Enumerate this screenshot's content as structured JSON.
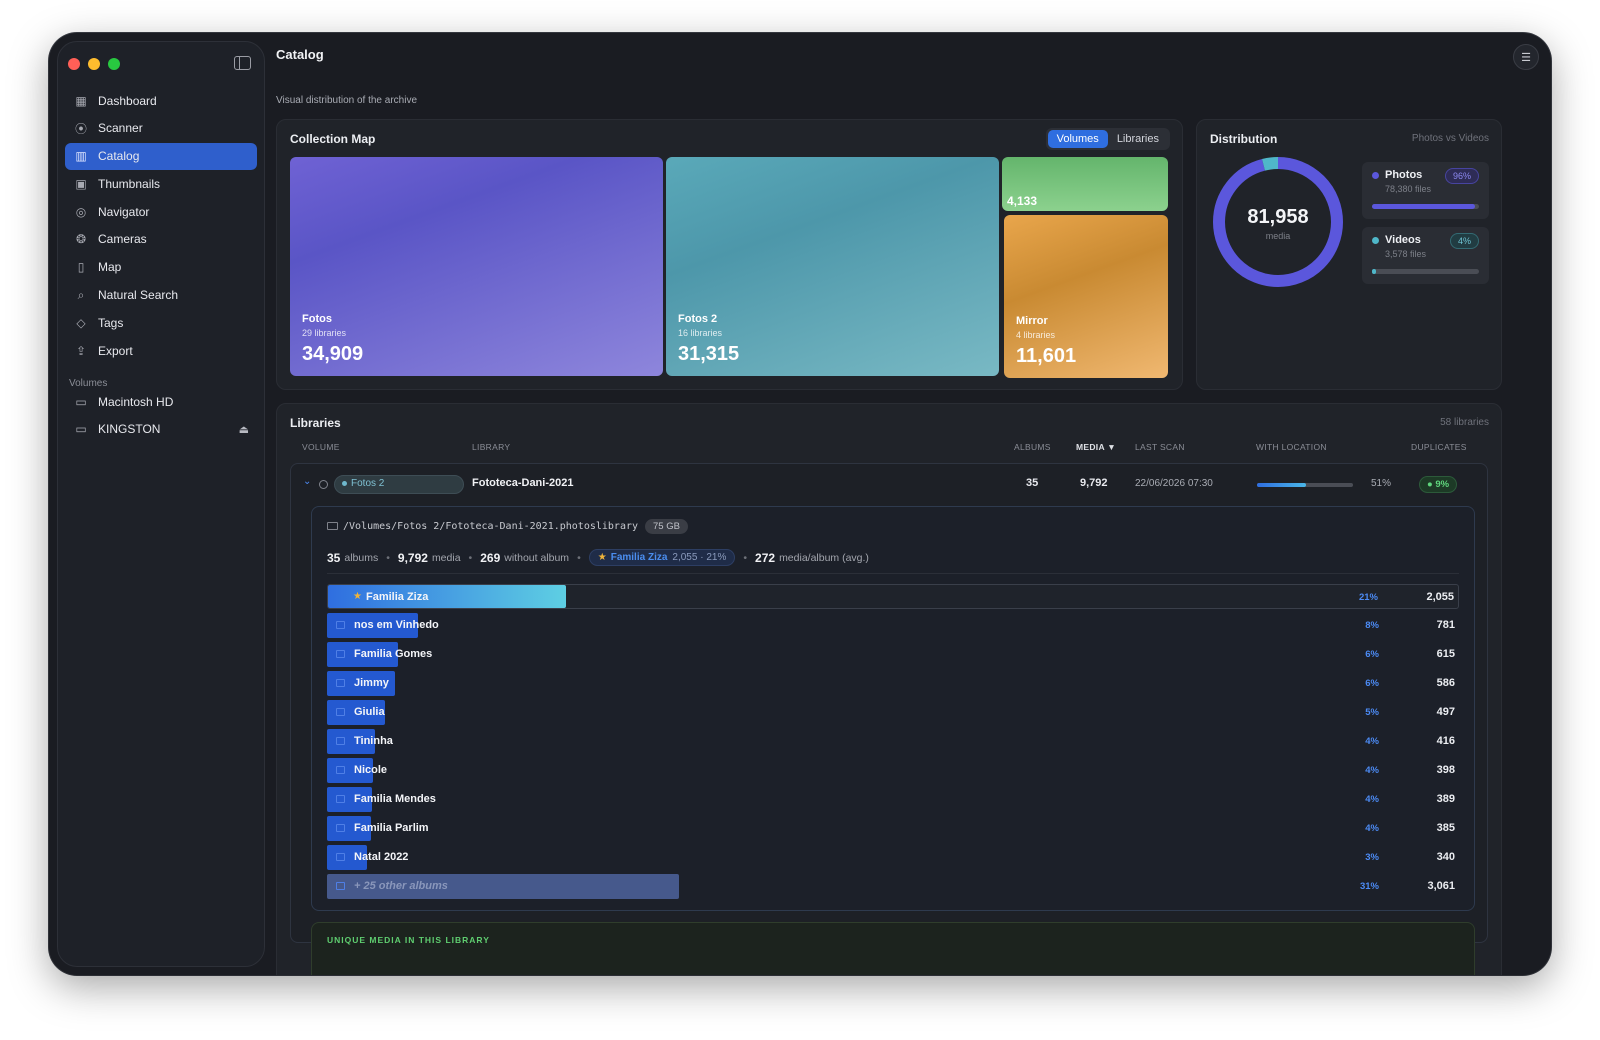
{
  "app": {
    "title": "Catalog",
    "subtitle": "Visual distribution of the archive"
  },
  "sidebar": {
    "items": [
      {
        "label": "Dashboard",
        "icon": "grid-icon",
        "glyph": "▦"
      },
      {
        "label": "Scanner",
        "icon": "broadcast-icon",
        "glyph": "⦿"
      },
      {
        "label": "Catalog",
        "icon": "catalog-icon",
        "glyph": "▥",
        "active": true
      },
      {
        "label": "Thumbnails",
        "icon": "photos-icon",
        "glyph": "▣"
      },
      {
        "label": "Navigator",
        "icon": "compass-icon",
        "glyph": "◎"
      },
      {
        "label": "Cameras",
        "icon": "aperture-icon",
        "glyph": "❂"
      },
      {
        "label": "Map",
        "icon": "map-icon",
        "glyph": "▯"
      },
      {
        "label": "Natural Search",
        "icon": "search-icon",
        "glyph": "⌕"
      },
      {
        "label": "Tags",
        "icon": "tag-icon",
        "glyph": "◇"
      },
      {
        "label": "Export",
        "icon": "share-icon",
        "glyph": "⇪"
      }
    ],
    "volumes_label": "Volumes",
    "volumes": [
      {
        "label": "Macintosh HD",
        "icon": "drive-icon"
      },
      {
        "label": "KINGSTON",
        "icon": "drive-icon",
        "eject": true
      }
    ]
  },
  "collection_map": {
    "title": "Collection Map",
    "toggle": [
      "Volumes",
      "Libraries"
    ],
    "toggle_selected": "Volumes",
    "tiles": [
      {
        "name": "Fotos",
        "sub": "29 libraries",
        "value": "34,909"
      },
      {
        "name": "Fotos 2",
        "sub": "16 libraries",
        "value": "31,315"
      },
      {
        "name": "",
        "sub": "",
        "value": "4,133"
      },
      {
        "name": "Mirror",
        "sub": "4 libraries",
        "value": "11,601"
      }
    ]
  },
  "distribution": {
    "title": "Distribution",
    "subtitle": "Photos vs Videos",
    "total": "81,958",
    "total_label": "media",
    "photos": {
      "name": "Photos",
      "files": "78,380 files",
      "pct": "96%",
      "fraction": 0.96,
      "color": "#5b57dc"
    },
    "videos": {
      "name": "Videos",
      "files": "3,578 files",
      "pct": "4%",
      "fraction": 0.04,
      "color": "#4fb7c9"
    }
  },
  "libraries": {
    "title": "Libraries",
    "count": "58 libraries",
    "headers": {
      "volume": "VOLUME",
      "library": "LIBRARY",
      "albums": "ALBUMS",
      "media": "MEDIA ▼",
      "last_scan": "LAST SCAN",
      "with_location": "WITH LOCATION",
      "duplicates": "DUPLICATES"
    },
    "row": {
      "volume": "Fotos 2",
      "library": "Fototeca-Dani-2021",
      "albums": "35",
      "media": "9,792",
      "last_scan": "22/06/2026 07:30",
      "location_pct": "51%",
      "location_fraction": 0.51,
      "duplicates": "9%"
    },
    "detail": {
      "path": "/Volumes/Fotos 2/Fototeca-Dani-2021.photoslibrary",
      "size": "75 GB",
      "stats": {
        "albums_n": "35",
        "albums_l": "albums",
        "media_n": "9,792",
        "media_l": "media",
        "noalbum_n": "269",
        "noalbum_l": "without album",
        "fav_name": "Familia Ziza",
        "fav_info": "2,055 · 21%",
        "avg_n": "272",
        "avg_l": "media/album (avg.)"
      },
      "albums": [
        {
          "name": "Familia Ziza",
          "pct": "21%",
          "count": "2,055",
          "fraction": 0.21,
          "favorite": true
        },
        {
          "name": "nos em Vinhedo",
          "pct": "8%",
          "count": "781",
          "fraction": 0.08
        },
        {
          "name": "Familia Gomes",
          "pct": "6%",
          "count": "615",
          "fraction": 0.063
        },
        {
          "name": "Jimmy",
          "pct": "6%",
          "count": "586",
          "fraction": 0.06
        },
        {
          "name": "Giulia",
          "pct": "5%",
          "count": "497",
          "fraction": 0.051
        },
        {
          "name": "Tininha",
          "pct": "4%",
          "count": "416",
          "fraction": 0.042
        },
        {
          "name": "Nicole",
          "pct": "4%",
          "count": "398",
          "fraction": 0.041
        },
        {
          "name": "Familia Mendes",
          "pct": "4%",
          "count": "389",
          "fraction": 0.04
        },
        {
          "name": "Familia Parlim",
          "pct": "4%",
          "count": "385",
          "fraction": 0.039
        },
        {
          "name": "Natal 2022",
          "pct": "3%",
          "count": "340",
          "fraction": 0.035
        },
        {
          "name": "+ 25 other albums",
          "pct": "31%",
          "count": "3,061",
          "fraction": 0.31,
          "other": true
        }
      ],
      "unique_label": "UNIQUE MEDIA IN THIS LIBRARY"
    }
  }
}
